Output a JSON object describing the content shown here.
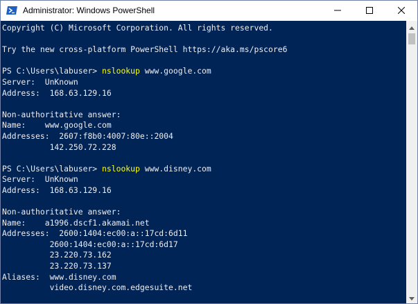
{
  "window": {
    "title": "Administrator: Windows PowerShell",
    "icon": "powershell-icon"
  },
  "controls": {
    "minimize_icon": "minimize-icon",
    "maximize_icon": "maximize-icon",
    "close_icon": "close-icon"
  },
  "console": {
    "prompt": "PS C:\\Users\\labuser> ",
    "command_color": "#ffff00",
    "text_color": "#eeedf0",
    "background": "#012456",
    "lines": [
      {
        "text": "Copyright (C) Microsoft Corporation. All rights reserved."
      },
      {
        "text": ""
      },
      {
        "text": "Try the new cross-platform PowerShell https://aka.ms/pscore6"
      },
      {
        "text": ""
      },
      {
        "prompt": "PS C:\\Users\\labuser> ",
        "command": "nslookup",
        "args": " www.google.com"
      },
      {
        "text": "Server:  UnKnown"
      },
      {
        "text": "Address:  168.63.129.16"
      },
      {
        "text": ""
      },
      {
        "text": "Non-authoritative answer:"
      },
      {
        "text": "Name:    www.google.com"
      },
      {
        "text": "Addresses:  2607:f8b0:4007:80e::2004"
      },
      {
        "text": "          142.250.72.228"
      },
      {
        "text": ""
      },
      {
        "prompt": "PS C:\\Users\\labuser> ",
        "command": "nslookup",
        "args": " www.disney.com"
      },
      {
        "text": "Server:  UnKnown"
      },
      {
        "text": "Address:  168.63.129.16"
      },
      {
        "text": ""
      },
      {
        "text": "Non-authoritative answer:"
      },
      {
        "text": "Name:    a1996.dscf1.akamai.net"
      },
      {
        "text": "Addresses:  2600:1404:ec00:a::17cd:6d11"
      },
      {
        "text": "          2600:1404:ec00:a::17cd:6d17"
      },
      {
        "text": "          23.220.73.162"
      },
      {
        "text": "          23.220.73.137"
      },
      {
        "text": "Aliases:  www.disney.com"
      },
      {
        "text": "          video.disney.com.edgesuite.net"
      },
      {
        "text": ""
      },
      {
        "prompt": "PS C:\\Users\\labuser> ",
        "cursor": true
      }
    ]
  },
  "scrollbar": {
    "up_icon": "scroll-up-arrow-icon",
    "down_icon": "scroll-down-arrow-icon"
  }
}
